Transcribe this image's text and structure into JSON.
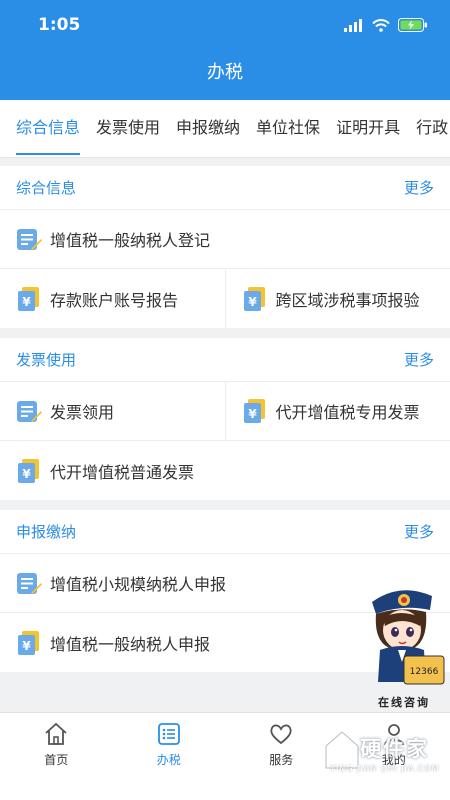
{
  "status": {
    "time": "1:05"
  },
  "header": {
    "title": "办税"
  },
  "tabs": [
    {
      "label": "综合信息",
      "active": true
    },
    {
      "label": "发票使用"
    },
    {
      "label": "申报缴纳"
    },
    {
      "label": "单位社保"
    },
    {
      "label": "证明开具"
    },
    {
      "label": "行政"
    }
  ],
  "sections": [
    {
      "title": "综合信息",
      "more": "更多",
      "rows": [
        [
          {
            "label": "增值税一般纳税人登记",
            "icon": "form-edit-icon"
          }
        ],
        [
          {
            "label": "存款账户账号报告",
            "icon": "yuan-doc-icon"
          },
          {
            "label": "跨区域涉税事项报验",
            "icon": "yuan-doc-icon"
          }
        ]
      ]
    },
    {
      "title": "发票使用",
      "more": "更多",
      "rows": [
        [
          {
            "label": "发票领用",
            "icon": "form-edit-icon"
          },
          {
            "label": "代开增值税专用发票",
            "icon": "yuan-doc-icon"
          }
        ],
        [
          {
            "label": "代开增值税普通发票",
            "icon": "yuan-doc-icon"
          }
        ]
      ]
    },
    {
      "title": "申报缴纳",
      "more": "更多",
      "rows": [
        [
          {
            "label": "增值税小规模纳税人申报",
            "icon": "form-edit-icon"
          }
        ],
        [
          {
            "label": "增值税一般纳税人申报",
            "icon": "yuan-doc-icon"
          }
        ]
      ]
    }
  ],
  "mascot": {
    "label": "在线咨询",
    "phone": "12366"
  },
  "bottom_nav": [
    {
      "label": "首页",
      "icon": "home-icon"
    },
    {
      "label": "办税",
      "icon": "list-icon",
      "active": true
    },
    {
      "label": "服务",
      "icon": "heart-icon"
    },
    {
      "label": "我的",
      "icon": "person-icon"
    }
  ],
  "watermark": {
    "text": "硬件家",
    "sub": "YING JIAN ZHI JIA.COM"
  },
  "colors": {
    "primary": "#2b8ee6",
    "icon_blue": "#6aaae8",
    "icon_yellow": "#f4c430"
  }
}
